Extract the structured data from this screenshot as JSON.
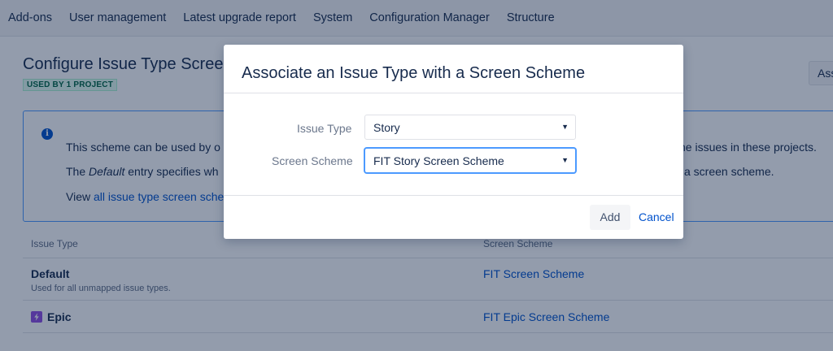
{
  "nav": {
    "items": [
      "Add-ons",
      "User management",
      "Latest upgrade report",
      "System",
      "Configuration Manager",
      "Structure"
    ]
  },
  "page": {
    "title": "Configure Issue Type Scree",
    "lozenge": "USED BY 1 PROJECT",
    "top_button": "Ass"
  },
  "info": {
    "line1_left": "This scheme can be used by o",
    "line1_right": "he issues in these projects.",
    "line2_prefix": "The ",
    "line2_em": "Default",
    "line2_rest": " entry specifies wh",
    "line2_right": "a screen scheme.",
    "line3_prefix": "View ",
    "line3_link": "all issue type screen sche"
  },
  "table": {
    "headers": [
      "Issue Type",
      "Screen Scheme"
    ],
    "rows": [
      {
        "name": "Default",
        "sub": "Used for all unmapped issue types.",
        "scheme": "FIT Screen Scheme"
      },
      {
        "name": "Epic",
        "sub": "",
        "scheme": "FIT Epic Screen Scheme"
      }
    ]
  },
  "dialog": {
    "title": "Associate an Issue Type with a Screen Scheme",
    "issue_type_label": "Issue Type",
    "issue_type_value": "Story",
    "screen_scheme_label": "Screen Scheme",
    "screen_scheme_value": "FIT Story Screen Scheme",
    "caret": "▼",
    "add_label": "Add",
    "cancel_label": "Cancel"
  },
  "colors": {
    "link": "#0052cc",
    "focus": "#4c9aff",
    "epic": "#904ee2",
    "lozenge_text": "#006644"
  }
}
